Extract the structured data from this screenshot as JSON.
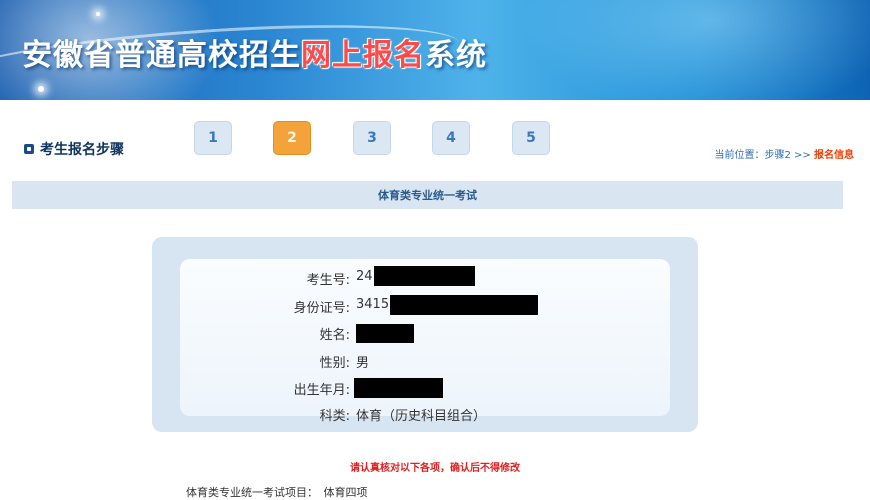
{
  "banner": {
    "title_part1": "安徽省普通高校招生",
    "title_highlight": "网上报名",
    "title_part2": "系统"
  },
  "steps": {
    "title": "考生报名步骤",
    "items": [
      "1",
      "2",
      "3",
      "4",
      "5"
    ],
    "active": "2",
    "breadcrumb_prefix": "当前位置：步骤2 >>",
    "breadcrumb_current": "报名信息"
  },
  "section": {
    "title": "体育类专业统一考试"
  },
  "info": {
    "exam_no_label": "考生号:",
    "exam_no_prefix": "24",
    "id_label": "身份证号:",
    "id_prefix": "3415",
    "name_label": "姓名:",
    "gender_label": "性别:",
    "gender_value": "男",
    "birth_label": "出生年月:",
    "subject_label": "科类:",
    "subject_value": "体育（历史科目组合）"
  },
  "notice": "请认真核对以下各项，确认后不得修改",
  "bottom_text": "体育类专业统一考试项目：　体育四项",
  "colors": {
    "banner_blue": "#2b86d2",
    "active_step": "#f4a33a",
    "notice_red": "#e32020",
    "breadcrumb_current": "#e8420c"
  }
}
